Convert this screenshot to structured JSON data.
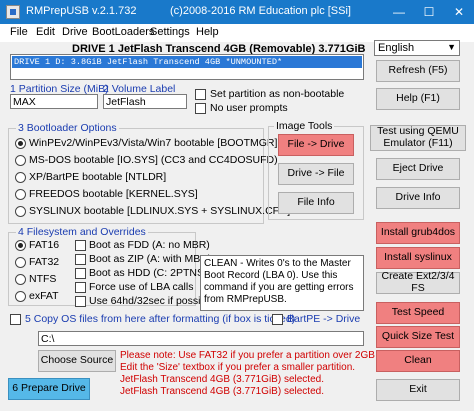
{
  "title_bar": {
    "app_name": "RMPrepUSB v.2.1.732",
    "copyright": "(c)2008-2016 RM Education plc [SSi]",
    "minimize": "—",
    "maximize": "☐",
    "close": "✕"
  },
  "menu": [
    "File",
    "Edit",
    "Drive",
    "BootLoaders",
    "Settings",
    "Help"
  ],
  "drive_header": "DRIVE 1  JetFlash Transcend 4GB  (Removable) 3.771GiB",
  "drive_list": [
    {
      "text": "DRIVE 1  D:    3.8GiB  JetFlash Transcend 4GB      *UNMOUNTED*"
    }
  ],
  "language": {
    "value": "English"
  },
  "partition_size": {
    "label": "1 Partition Size (MiB)",
    "value": "MAX"
  },
  "volume_label": {
    "label": "2 Volume Label",
    "value": "JetFlash"
  },
  "options": {
    "non_bootable": "Set partition as non-bootable",
    "no_prompts": "No user prompts"
  },
  "bootloader": {
    "title": "3 Bootloader Options",
    "items": [
      "WinPEv2/WinPEv3/Vista/Win7 bootable [BOOTMGR] (CC4)",
      "MS-DOS bootable [IO.SYS]   (CC3 and CC4DOSUFD)",
      "XP/BartPE bootable [NTLDR]",
      "FREEDOS bootable [KERNEL.SYS]",
      "SYSLINUX bootable [LDLINUX.SYS + SYSLINUX.CFG]"
    ],
    "selected": 0
  },
  "image_tools": {
    "title": "Image Tools",
    "file_to_drive": "File -> Drive",
    "drive_to_file": "Drive -> File",
    "file_info": "File Info"
  },
  "filesystem": {
    "title": "4 Filesystem and Overrides",
    "types": [
      "FAT16",
      "FAT32",
      "NTFS",
      "exFAT"
    ],
    "selected": 0,
    "overrides": [
      "Boot as FDD (A: no MBR)",
      "Boot as ZIP (A: with MBR)",
      "Boot as HDD (C: 2PTNS)",
      "Force use of LBA calls",
      "Use 64hd/32sec if possible"
    ]
  },
  "info_text": "CLEAN - Writes 0's to the Master Boot Record (LBA 0). Use this command if you are getting errors from RMPrepUSB.",
  "copy_os": {
    "label": "5 Copy OS files from here after formatting (if box is ticked)",
    "path": "C:\\",
    "bartpe": "BartPE -> Drive",
    "choose_source": "Choose Source"
  },
  "messages": [
    {
      "text": "Please note: Use FAT32 if you prefer a partition over 2GB in size.",
      "color": "#d00000"
    },
    {
      "text": "Edit the 'Size' textbox if you prefer a smaller partition.",
      "color": "#d00000"
    },
    {
      "text": "JetFlash Transcend 4GB (3.771GiB) selected.",
      "color": "#d00000"
    },
    {
      "text": "JetFlash Transcend 4GB (3.771GiB) selected.",
      "color": "#d00000"
    }
  ],
  "prepare_drive": "6 Prepare Drive",
  "right_panel": {
    "refresh": "Refresh (F5)",
    "help": "Help (F1)",
    "test_qemu": "Test using QEMU Emulator (F11)",
    "eject": "Eject Drive",
    "drive_info": "Drive Info",
    "install_grub4dos": "Install grub4dos",
    "install_syslinux": "Install syslinux",
    "create_ext": "Create Ext2/3/4 FS",
    "test_speed": "Test Speed",
    "quick_size_test": "Quick Size Test",
    "clean": "Clean",
    "exit": "Exit"
  },
  "colors": {
    "titlebar": "#1979ca",
    "selection": "#2a78d6",
    "red_button": "#f08080",
    "blue_button": "#55b8e8",
    "group_label": "#1a3cb0"
  }
}
